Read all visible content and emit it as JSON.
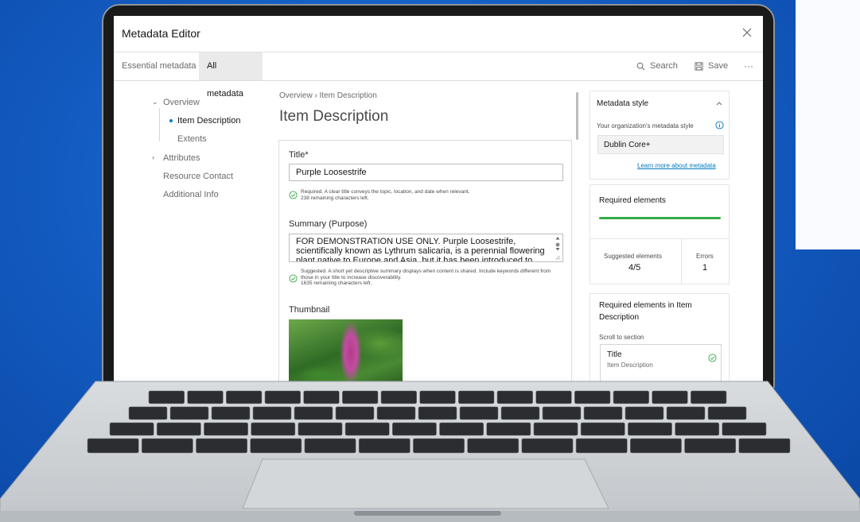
{
  "app": {
    "title": "Metadata Editor"
  },
  "tabs": {
    "essential": "Essential metadata",
    "all": "All metadata"
  },
  "toolbar": {
    "search": "Search",
    "save": "Save",
    "more": "···"
  },
  "nav": {
    "overview": "Overview",
    "item_description": "Item Description",
    "extents": "Extents",
    "attributes": "Attributes",
    "resource_contact": "Resource Contact",
    "additional_info": "Additional Info"
  },
  "content": {
    "breadcrumb": "Overview  ›  Item Description",
    "title": "Item Description",
    "title_field": {
      "label": "Title*",
      "value": "Purple Loosestrife",
      "hint": "Required. A clear title conveys the topic, location, and date when relevant.",
      "remaining": "238 remaining characters left."
    },
    "summary_field": {
      "label": "Summary (Purpose)",
      "value": "FOR DEMONSTRATION USE ONLY. Purple Loosestrife, scientifically known as Lythrum salicaria, is a perennial flowering plant native to Europe and Asia, but it has been introduced to North America. It is",
      "hint": "Suggested. A short yet descriptive summary displays when content is shared. Include keywords different from those in your title to increase discoverability.",
      "remaining": "1635 remaining characters left."
    },
    "thumbnail_label": "Thumbnail"
  },
  "metadata_style": {
    "title": "Metadata style",
    "org_label": "Your organization's metadata style",
    "value": "Dublin Core+",
    "link": "Learn more about metadata"
  },
  "required": {
    "title": "Required elements",
    "progress": 1.0,
    "suggested_label": "Suggested elements",
    "suggested_value": "4/5",
    "errors_label": "Errors",
    "errors_value": "1"
  },
  "section_panel": {
    "title": "Required elements in Item Description",
    "scroll_label": "Scroll to section",
    "row_title": "Title",
    "row_sub": "Item Description"
  },
  "colors": {
    "background": "#1258bd",
    "accent": "#007ac2",
    "success": "#35ac46"
  }
}
